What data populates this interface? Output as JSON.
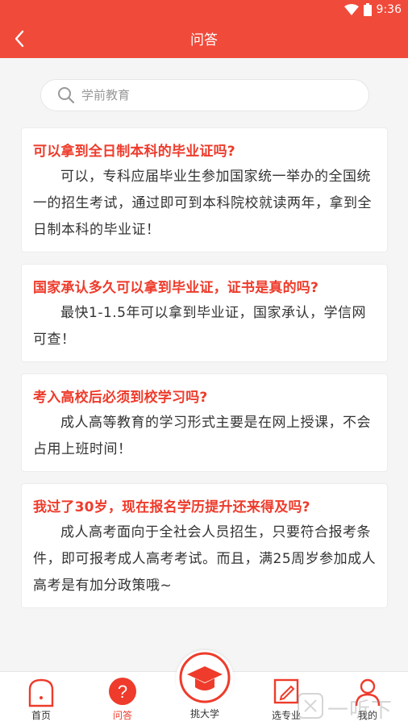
{
  "status_bar": {
    "time": "9:36"
  },
  "header": {
    "title": "问答"
  },
  "search": {
    "placeholder": "学前教育"
  },
  "qa_items": [
    {
      "question": "可以拿到全日制本科的毕业证吗?",
      "answer": "可以，专科应届毕业生参加国家统一举办的全国统一的招生考试，通过即可到本科院校就读两年，拿到全日制本科的毕业证！"
    },
    {
      "question": "国家承认多久可以拿到毕业证，证书是真的吗?",
      "answer": "最快1-1.5年可以拿到毕业证，国家承认，学信网可查！"
    },
    {
      "question": "考入高校后必须到校学习吗?",
      "answer": "成人高等教育的学习形式主要是在网上授课，不会占用上班时间！"
    },
    {
      "question": "我过了30岁，现在报名学历提升还来得及吗?",
      "answer": "成人高考面向于全社会人员招生，只要符合报考条件，即可报考成人高考考试。而且，满25周岁参加成人高考是有加分政策哦~"
    }
  ],
  "tabbar": {
    "home": "首页",
    "qa": "问答",
    "pick": "挑大学",
    "major": "选专业",
    "mine": "我的"
  },
  "watermark": {
    "text": "一听下载"
  },
  "colors": {
    "accent": "#f04a3a",
    "question": "#ee3b2b"
  }
}
